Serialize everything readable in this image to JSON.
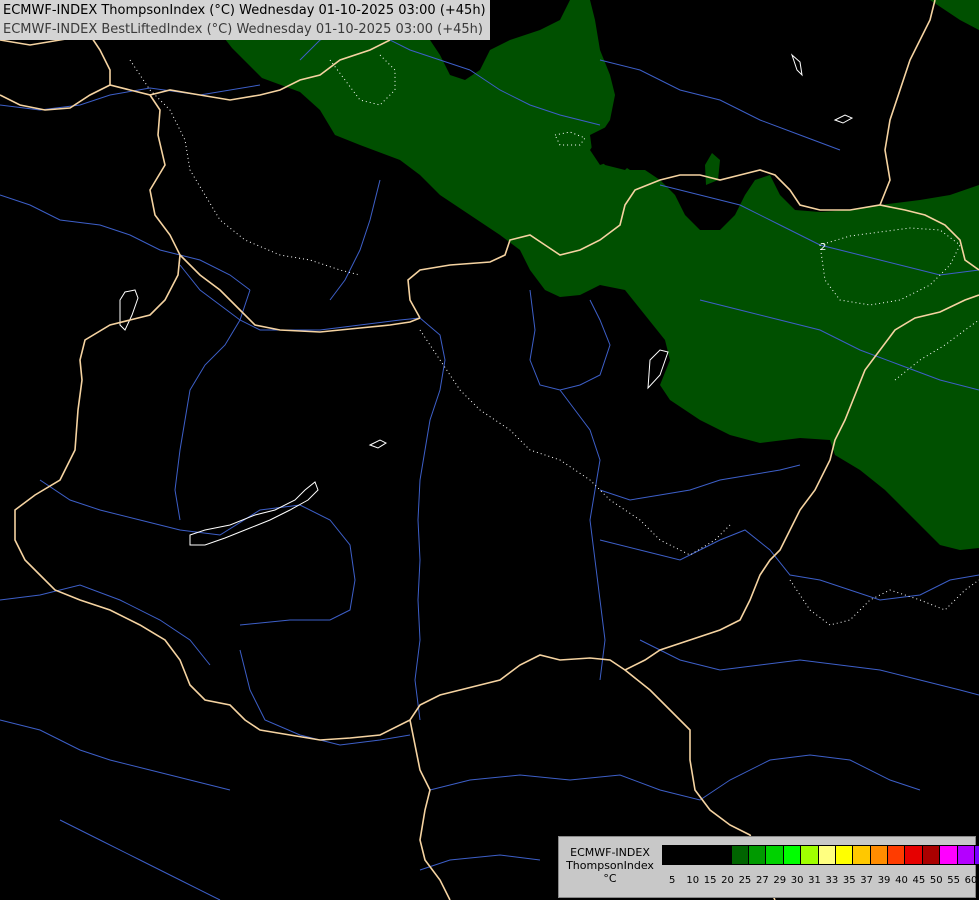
{
  "header": {
    "line1": "ECMWF-INDEX ThompsonIndex (°C) Wednesday 01-10-2025 03:00 (+45h)",
    "line2": "ECMWF-INDEX BestLiftedIndex (°C) Wednesday 01-10-2025 03:00 (+45h)"
  },
  "map": {
    "background_color": "#000000",
    "fill_color": "#005000",
    "border_color": "#f5d3a1",
    "river_color": "#3d5fc8",
    "contour_color": "#ffffff",
    "contour_label": "2"
  },
  "legend": {
    "model": "ECMWF-INDEX",
    "index": "ThompsonIndex",
    "unit": "°C",
    "swatches": [
      {
        "value": "5",
        "color": "#000000"
      },
      {
        "value": "10",
        "color": "#000000"
      },
      {
        "value": "15",
        "color": "#000000"
      },
      {
        "value": "20",
        "color": "#000000"
      },
      {
        "value": "25",
        "color": "#006400"
      },
      {
        "value": "27",
        "color": "#009a00"
      },
      {
        "value": "29",
        "color": "#00d200"
      },
      {
        "value": "30",
        "color": "#00ff00"
      },
      {
        "value": "31",
        "color": "#a0ff00"
      },
      {
        "value": "33",
        "color": "#ffff80"
      },
      {
        "value": "35",
        "color": "#ffff00"
      },
      {
        "value": "37",
        "color": "#ffc800"
      },
      {
        "value": "39",
        "color": "#ff8c00"
      },
      {
        "value": "40",
        "color": "#ff3c00"
      },
      {
        "value": "45",
        "color": "#e60000"
      },
      {
        "value": "50",
        "color": "#aa0000"
      },
      {
        "value": "55",
        "color": "#ff00ff"
      },
      {
        "value": "60",
        "color": "#b400ff"
      }
    ],
    "extra_swatches": [
      {
        "color": "#7800ff"
      },
      {
        "color": "#0000ff"
      }
    ]
  }
}
